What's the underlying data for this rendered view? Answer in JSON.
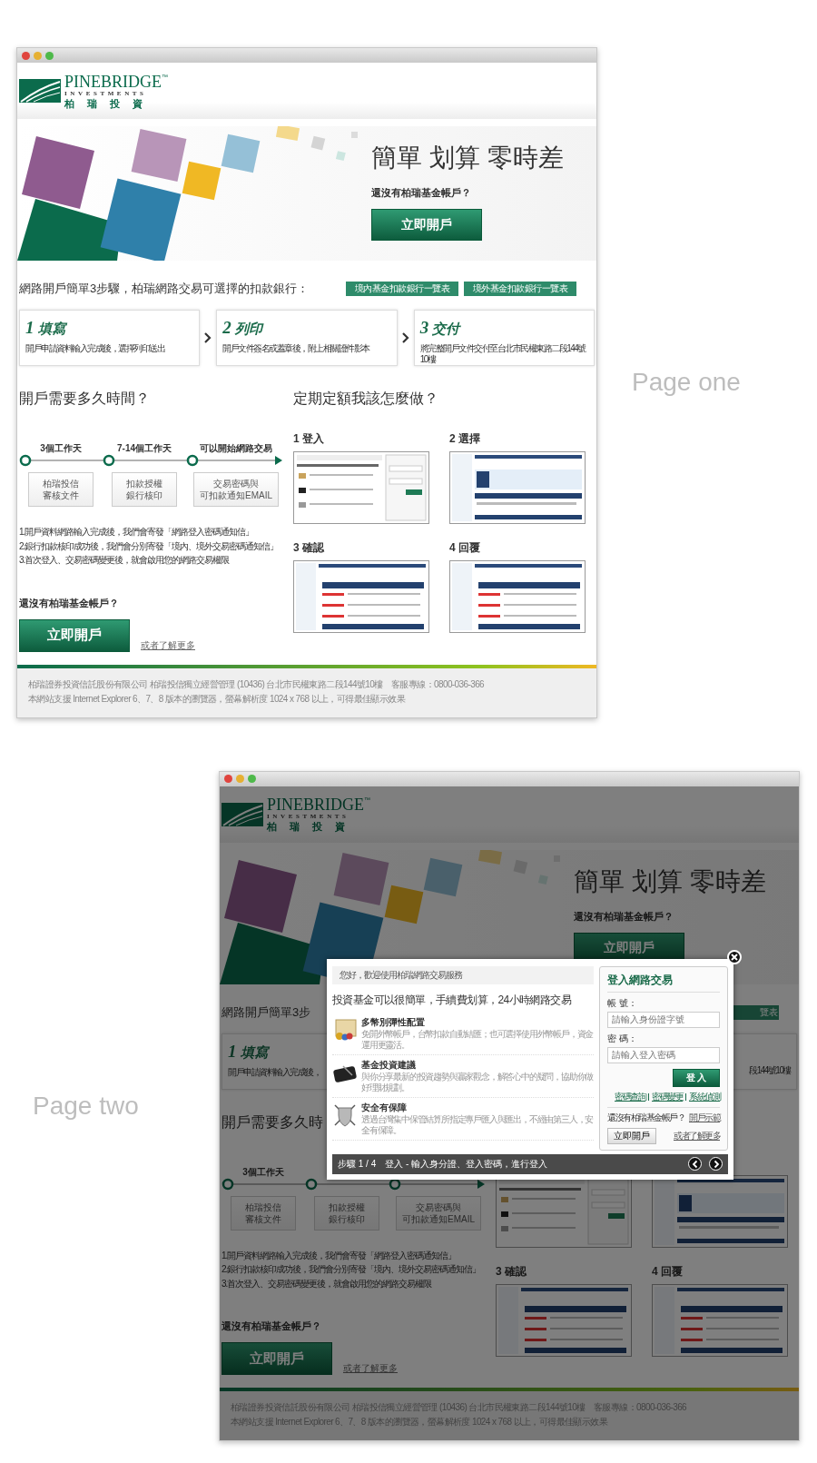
{
  "pages": [
    {
      "caption": "Page one",
      "logo": {
        "name": "PINEBRIDGE",
        "tm": "™",
        "sub": "INVESTMENTS",
        "chinese": "柏瑞投資"
      },
      "hero": {
        "title": "簡單 划算 零時差",
        "question": "還沒有柏瑞基金帳戶？",
        "button": "立即開戶"
      },
      "banks": {
        "heading": "網路開戶簡單3步驟，柏瑞網路交易可選擇的扣款銀行：",
        "buttons": [
          {
            "label": "境內基金扣款銀行一覽表"
          },
          {
            "label": "境外基金扣款銀行一覽表"
          }
        ]
      },
      "steps": [
        {
          "number": "1",
          "title": "填寫",
          "text": "開戶申請資料輸入完成後，選擇列印送出"
        },
        {
          "number": "2",
          "title": "列印",
          "text": "開戶文件簽名或蓋章後，附上相關證件影本"
        },
        {
          "number": "3",
          "title": "交付",
          "text": "將完整開戶文件交付至台北市民權東路二段144號10樓"
        }
      ],
      "duration": {
        "heading": "開戶需要多久時間？",
        "stages": [
          {
            "label": "3個工作天",
            "box": [
              "柏瑞投信",
              "審核文件"
            ]
          },
          {
            "label": "7-14個工作天",
            "box": [
              "扣款授權",
              "銀行核印"
            ]
          },
          {
            "label": "可以開始網路交易",
            "box": [
              "交易密碼與",
              "可扣款通知EMAIL"
            ]
          }
        ],
        "notes": [
          "1.開戶資料網路輸入完成後，我們會寄發「網路登入密碼通知信」",
          "2.銀行扣款核印成功後，我們會分別寄發「境內、境外交易密碼通知信」",
          "3.首次登入、交易密碼變更後，就會啟用您的網路交易權限"
        ]
      },
      "howto": {
        "heading": "定期定額我該怎麼做？",
        "shots": [
          {
            "label": "1 登入",
            "kind": "login"
          },
          {
            "label": "2 選擇",
            "kind": "form"
          },
          {
            "label": "3 確認",
            "kind": "table"
          },
          {
            "label": "4 回覆",
            "kind": "table"
          }
        ]
      },
      "signup": {
        "question": "還沒有柏瑞基金帳戶？",
        "button": "立即開戶",
        "link": "或者了解更多"
      },
      "footer": [
        "柏瑞證券投資信託股份有限公司 柏瑞投信獨立經營管理 (10436) 台北市民權東路二段144號10樓　客服專線：0800-036-366",
        "本網站支援 Internet Explorer 6、7、8 版本的瀏覽器，螢幕解析度 1024 x 768 以上，可得最佳顯示效果"
      ]
    },
    {
      "caption": "Page two",
      "logo": {
        "name": "PINEBRIDGE",
        "tm": "™",
        "sub": "INVESTMENTS",
        "chinese": "柏瑞投資"
      },
      "hero": {
        "title": "簡單 划算 零時差",
        "question": "還沒有柏瑞基金帳戶？",
        "button": "立即開戶"
      },
      "banks": {
        "heading": "網路開戶簡單3步",
        "buttons": [
          {
            "label": "覽表",
            "cut_at_start": true
          }
        ]
      },
      "steps": [
        {
          "number": "1",
          "title": "填寫",
          "text": "開戶申請資料輸入完成後，"
        },
        {
          "text": "段144號10樓",
          "cut_at_start": true
        }
      ],
      "duration": {
        "heading": "開戶需要多久時",
        "stages": [
          {
            "label": "3個工作天",
            "box": [
              "柏瑞投信",
              "審核文件"
            ]
          },
          {
            "box": [
              "扣款授權",
              "銀行核印"
            ]
          },
          {
            "box": [
              "交易密碼與",
              "可扣款通知EMAIL"
            ]
          }
        ],
        "notes": [
          "1.開戶資料網路輸入完成後，我們會寄發「網路登入密碼通知信」",
          "2.銀行扣款核印成功後，我們會分別寄發「境內、境外交易密碼通知信」",
          "3.首次登入、交易密碼變更後，就會啟用您的網路交易權限"
        ]
      },
      "howto": {
        "shots": [
          {
            "kind": "login"
          },
          {
            "kind": "form"
          },
          {
            "label": "3 確認",
            "kind": "table"
          },
          {
            "label": "4 回覆",
            "kind": "table"
          }
        ]
      },
      "signup": {
        "question": "還沒有柏瑞基金帳戶？",
        "button": "立即開戶",
        "link": "或者了解更多"
      },
      "footer": [
        "柏瑞證券投資信託股份有限公司 柏瑞投信獨立經營管理 (10436) 台北市民權東路二段144號10樓　客服專線：0800-036-366",
        "本網站支援 Internet Explorer 6、7、8 版本的瀏覽器，螢幕解析度 1024 x 768 以上，可得最佳顯示效果"
      ],
      "modal": {
        "greeting": "您好，歡迎使用柏瑞網路交易服務",
        "headline": "投資基金可以很簡單，手續費划算，24小時網路交易",
        "features": [
          {
            "kind": "currency",
            "title": "多幣別彈性配置",
            "text": "免開外幣帳戶，台幣扣款自動結匯；也可選擇使用外幣帳戶，資金運用更靈活。"
          },
          {
            "kind": "advice",
            "title": "基金投資建議",
            "text": "與你分享最新的投資趨勢與贏家觀念，解答心中的疑問，協助你做好理財規劃。"
          },
          {
            "kind": "security",
            "title": "安全有保障",
            "text": "透過台灣集中保管結算所指定專戶匯入與匯出，不經由第三人，安全有保障。"
          }
        ],
        "login": {
          "title": "登入網路交易",
          "account_label": "帳 號：",
          "account_placeholder": "請輸入身份證字號",
          "password_label": "密 碼：",
          "password_placeholder": "請輸入登入密碼",
          "button": "登 入",
          "links": [
            "密碼查詢",
            "密碼變更",
            "系統偵測"
          ],
          "question": "還沒有柏瑞基金帳戶？",
          "demo_link": "開戶示範",
          "button2": "立即開戶",
          "more_link": "或者了解更多"
        },
        "step_bar": "步驟 1 / 4　登入 - 輸入身分證、登入密碼，進行登入"
      }
    }
  ]
}
